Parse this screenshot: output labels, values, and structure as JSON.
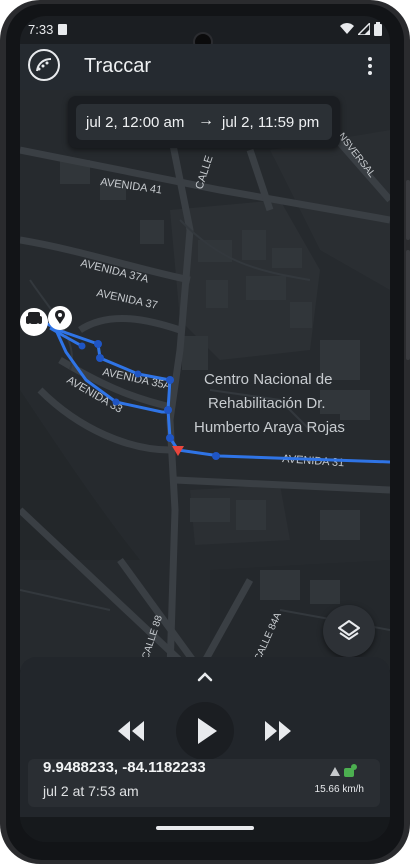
{
  "status_bar": {
    "time": "7:33"
  },
  "app_bar": {
    "title": "Traccar",
    "logo_icon": "traccar-logo-icon",
    "menu_icon": "more-vert-icon"
  },
  "date_range": {
    "from": "jul 2, 12:00 am",
    "arrow": "→",
    "to": "jul 2, 11:59 pm"
  },
  "map": {
    "street_labels": [
      "AVENIDA 41",
      "CALLE",
      "NSVERSAL",
      "AVENIDA 37A",
      "AVENIDA 37",
      "AVENIDA 35A",
      "AVENIDA 33",
      "AVENIDA 31",
      "CALLE 88",
      "CALLE 84A"
    ],
    "poi_name": [
      "Centro Nacional de",
      "Rehabilitación Dr.",
      "Humberto Araya Rojas"
    ],
    "route_color": "#2f74e6",
    "route_point_color": "#1f55c4",
    "current_marker_color": "#e8453c",
    "layers_icon": "layers-icon"
  },
  "player": {
    "expand_icon": "chevron-up-icon",
    "rewind_icon": "rewind-icon",
    "play_icon": "play-icon",
    "forward_icon": "fast-forward-icon"
  },
  "position": {
    "coordinates": "9.9488233, -84.1182233",
    "time": "jul 2 at 7:53 am",
    "speed": "15.66 km/h",
    "status_color": "#4caf50"
  }
}
